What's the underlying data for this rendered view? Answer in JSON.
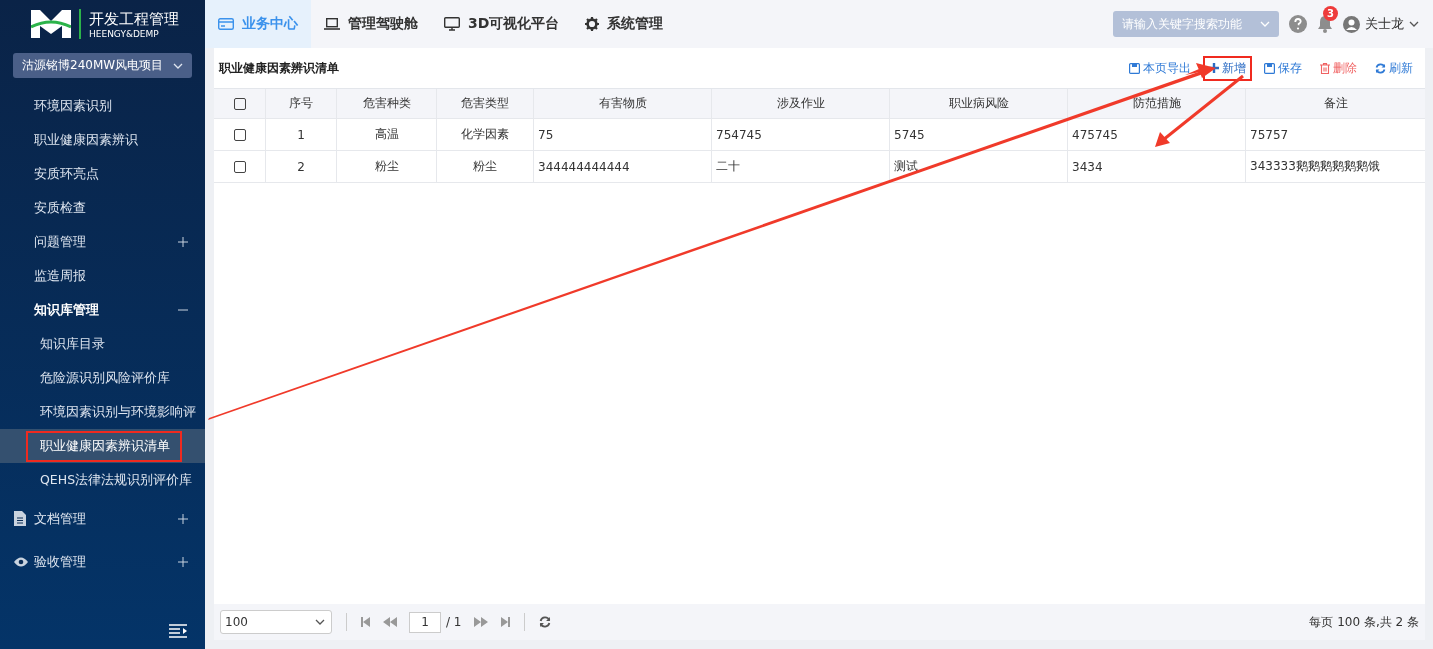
{
  "logo": {
    "title": "开发工程管理",
    "subtitle": "HEENGY&DEMP"
  },
  "project_select": {
    "value": "沽源铭博240MW风电项目"
  },
  "sidebar": {
    "items": [
      {
        "label": "环境因素识别",
        "kind": "plain",
        "selected": false
      },
      {
        "label": "职业健康因素辨识",
        "kind": "plain",
        "selected": false
      },
      {
        "label": "安质环亮点",
        "kind": "plain",
        "selected": false
      },
      {
        "label": "安质检查",
        "kind": "plain",
        "selected": false
      },
      {
        "label": "问题管理",
        "kind": "plain",
        "selected": false,
        "expanded": false
      },
      {
        "label": "监造周报",
        "kind": "plain",
        "selected": false
      },
      {
        "label": "知识库管理",
        "kind": "plain",
        "selected": false,
        "expanded": true,
        "children": [
          {
            "label": "知识库目录",
            "selected": false,
            "highlighted": false
          },
          {
            "label": "危险源识别风险评价库",
            "selected": false,
            "highlighted": false
          },
          {
            "label": "环境因素识别与环境影响评",
            "selected": false,
            "highlighted": false
          },
          {
            "label": "职业健康因素辨识清单",
            "selected": true,
            "highlighted": true
          },
          {
            "label": "QEHS法律法规识别评价库",
            "selected": false,
            "highlighted": false
          }
        ]
      },
      {
        "label": "文档管理",
        "kind": "document",
        "selected": false,
        "expanded": false
      },
      {
        "label": "验收管理",
        "kind": "eye",
        "selected": false,
        "expanded": false
      }
    ]
  },
  "tabs": [
    {
      "label": "业务中心",
      "kind": "card",
      "selected": true
    },
    {
      "label": "管理驾驶舱",
      "kind": "laptop",
      "selected": false
    },
    {
      "label": "3D可视化平台",
      "kind": "monitor",
      "selected": false
    },
    {
      "label": "系统管理",
      "kind": "gear",
      "selected": false
    }
  ],
  "search": {
    "placeholder": "请输入关键字搜索功能"
  },
  "notifications": {
    "count": "3"
  },
  "user": {
    "name": "关士龙"
  },
  "panel": {
    "title": "职业健康因素辨识清单"
  },
  "toolbar": [
    {
      "label": "本页导出",
      "kind": "export",
      "highlighted": false
    },
    {
      "label": "新增",
      "kind": "add",
      "highlighted": true
    },
    {
      "label": "保存",
      "kind": "save",
      "highlighted": false
    },
    {
      "label": "删除",
      "kind": "delete",
      "highlighted": false
    },
    {
      "label": "刷新",
      "kind": "refresh",
      "highlighted": false
    }
  ],
  "table": {
    "header_checked": false,
    "columns": [
      "序号",
      "危害种类",
      "危害类型",
      "有害物质",
      "涉及作业",
      "职业病风险",
      "防范措施",
      "备注"
    ],
    "rows": [
      {
        "checked": false,
        "cells": [
          "1",
          "高温",
          "化学因素",
          "75",
          "754745",
          "5745",
          "475745",
          "75757"
        ]
      },
      {
        "checked": false,
        "cells": [
          "2",
          "粉尘",
          "粉尘",
          "344444444444",
          "二十",
          "测试",
          "3434",
          "343333鹅鹅鹅鹅鹅鹅饿"
        ]
      }
    ]
  },
  "pager": {
    "page_size": "100",
    "page": "1",
    "total_pages": "/ 1",
    "summary": "每页 100 条,共 2 条"
  }
}
